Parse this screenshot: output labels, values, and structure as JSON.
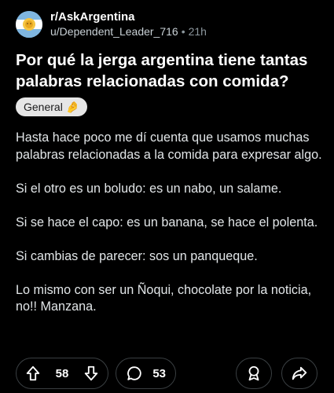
{
  "post": {
    "subreddit": "r/AskArgentina",
    "author": "u/Dependent_Leader_716",
    "separator": "•",
    "age": "21h",
    "title": "Por qué la jerga argentina tiene tantas palabras relacionadas con comida?",
    "flair": {
      "label": "General",
      "emoji": "🤌"
    },
    "paragraphs": [
      "Hasta hace poco me dí cuenta que usamos muchas palabras relacionadas a la comida para expresar algo.",
      "Si el otro es un boludo: es un nabo, un salame.",
      "Si se hace el capo: es un banana, se hace el polenta.",
      "Si cambias de parecer: sos un panqueque.",
      "Lo mismo con ser un Ñoqui, chocolate por la noticia, no!! Manzana."
    ]
  },
  "actions": {
    "upvotes": "58",
    "comments": "53"
  },
  "colors": {
    "background": "#000000",
    "pill_border": "#3a3f42",
    "flair_bg": "#e6e6e6",
    "avatar_bg": "#7fb6e0"
  },
  "icons": {
    "avatar": "argentina-sun-icon",
    "upvote": "arrow-up-icon",
    "downvote": "arrow-down-icon",
    "comment": "comment-bubble-icon",
    "award": "award-icon",
    "share": "share-icon"
  }
}
